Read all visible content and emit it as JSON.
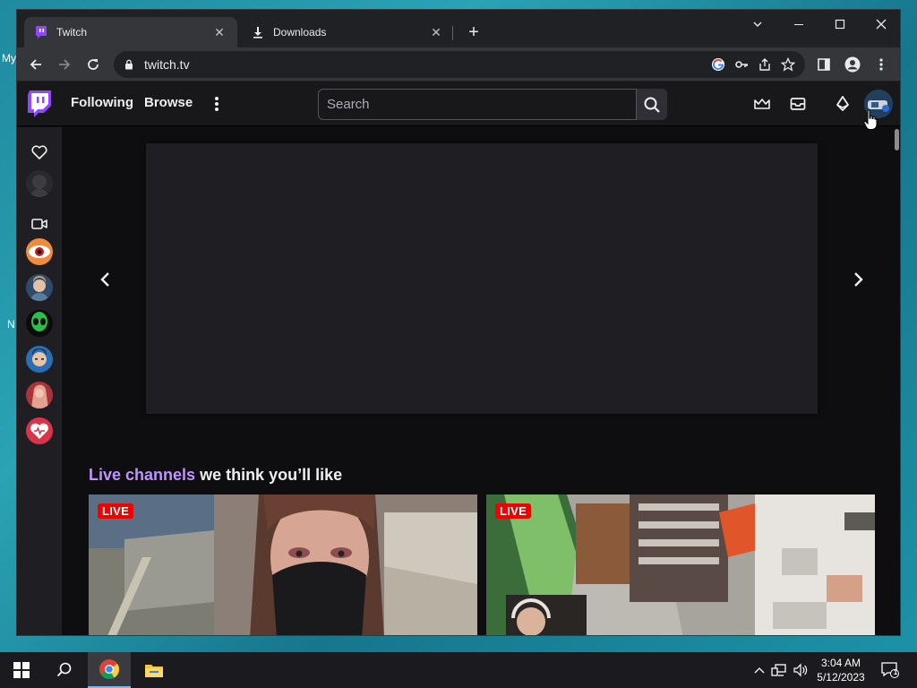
{
  "desktop": {
    "label_my": "My",
    "label_n": "N"
  },
  "browser": {
    "tabs": [
      {
        "title": "Twitch",
        "active": true,
        "favicon": "twitch-icon"
      },
      {
        "title": "Downloads",
        "active": false,
        "favicon": "download-icon"
      }
    ],
    "url": "twitch.tv"
  },
  "twitch": {
    "nav": {
      "following": "Following",
      "browse": "Browse"
    },
    "search": {
      "placeholder": "Search"
    },
    "section": {
      "accent": "Live channels",
      "rest": " we think you’ll like"
    },
    "cards": [
      {
        "badge": "LIVE"
      },
      {
        "badge": "LIVE"
      }
    ],
    "colors": {
      "brand": "#9146ff",
      "accent_text": "#bf94ff",
      "live": "#eb0400"
    }
  },
  "taskbar": {
    "time": "3:04 AM",
    "date": "5/12/2023",
    "notification_count": "1"
  }
}
